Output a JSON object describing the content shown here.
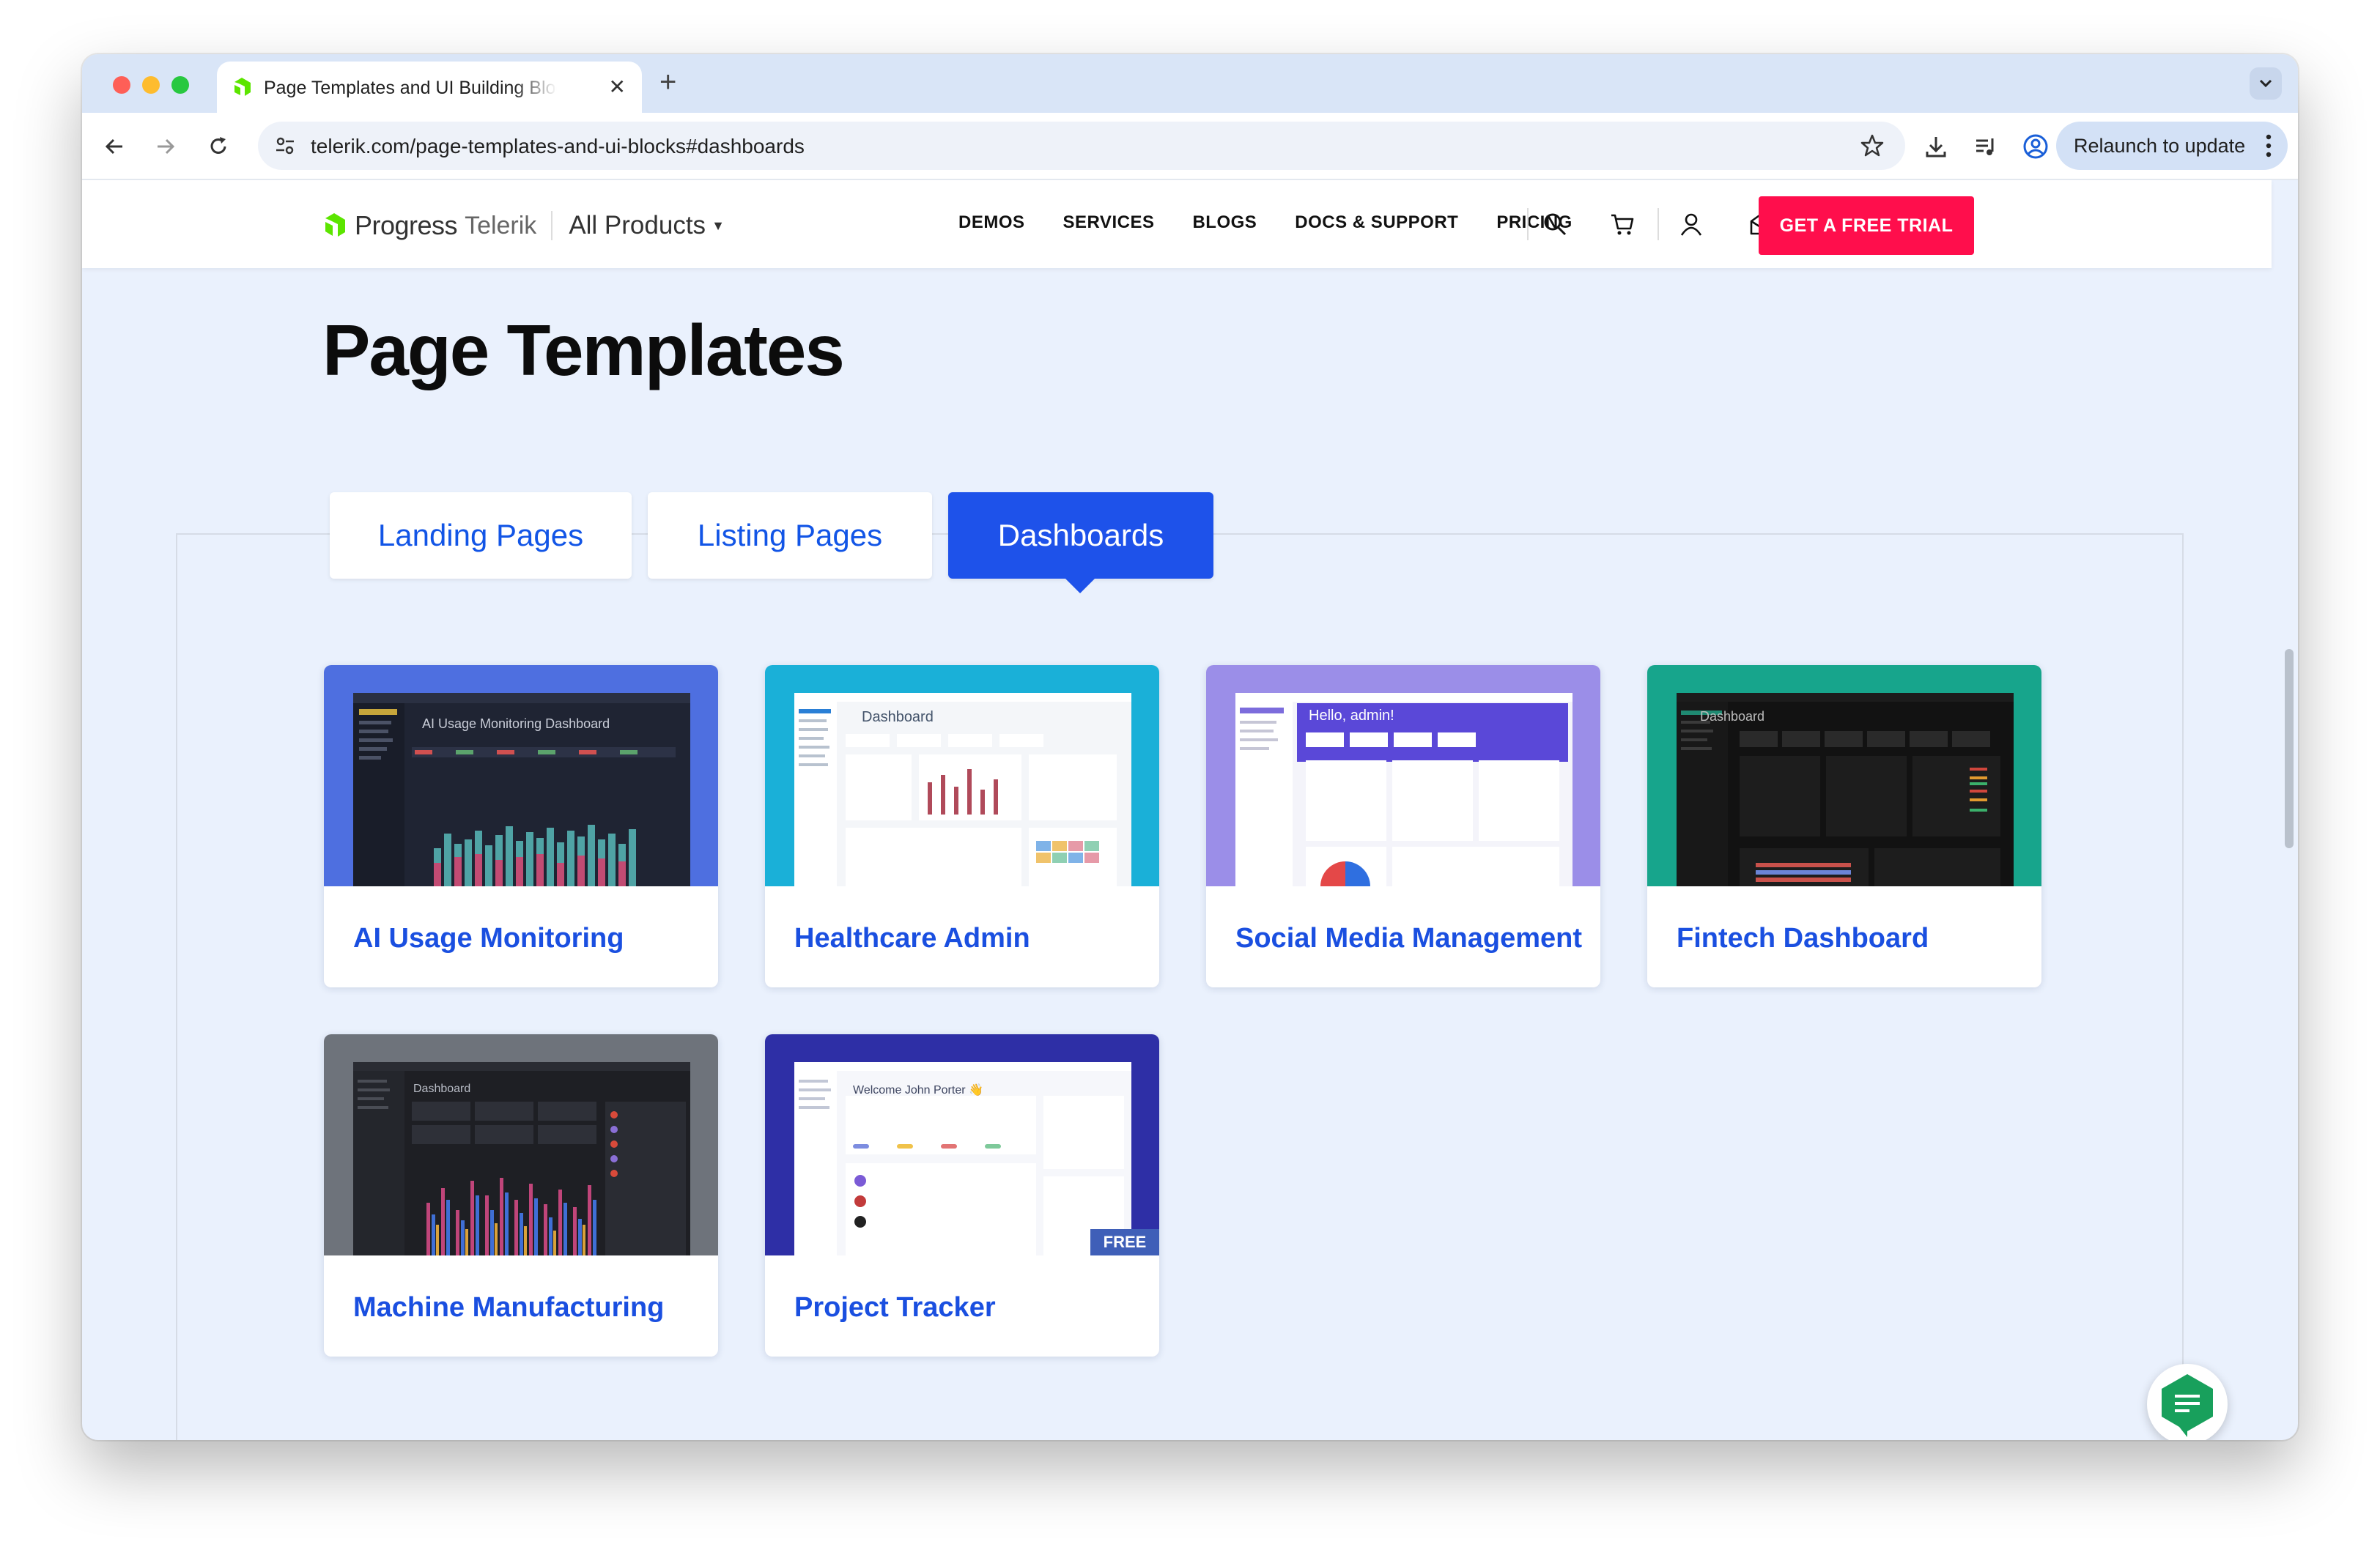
{
  "browser": {
    "tab_title": "Page Templates and UI Building Blocks",
    "tab_close": "✕",
    "new_tab": "+",
    "url": "telerik.com/page-templates-and-ui-blocks#dashboards",
    "relaunch_label": "Relaunch to update"
  },
  "header": {
    "logo_progress": "Progress",
    "logo_telerik": "Telerik",
    "all_products": "All Products",
    "nav": [
      "DEMOS",
      "SERVICES",
      "BLOGS",
      "DOCS & SUPPORT",
      "PRICING"
    ],
    "trial_button": "GET A FREE TRIAL"
  },
  "main": {
    "title": "Page Templates",
    "tabs": [
      {
        "label": "Landing Pages",
        "active": false
      },
      {
        "label": "Listing Pages",
        "active": false
      },
      {
        "label": "Dashboards",
        "active": true
      }
    ],
    "cards": [
      {
        "title": "AI Usage Monitoring",
        "thumb_title": "AI Usage Monitoring Dashboard",
        "theme": "#4e6fe0"
      },
      {
        "title": "Healthcare Admin",
        "thumb_title": "Dashboard",
        "theme": "#1ab0d8"
      },
      {
        "title": "Social Media Management",
        "thumb_title": "Hello, admin!",
        "theme": "#9b8ee8"
      },
      {
        "title": "Fintech Dashboard",
        "thumb_title": "Dashboard",
        "theme": "#17a58c"
      },
      {
        "title": "Machine Manufacturing",
        "thumb_title": "Dashboard",
        "theme": "#6e737b"
      },
      {
        "title": "Project Tracker",
        "thumb_title": "Welcome John Porter 👋",
        "theme": "#2e2fa6",
        "badge": "FREE"
      }
    ]
  },
  "colors": {
    "accent": "#1e52ea",
    "cta": "#ff0e4c",
    "brand_green": "#5ce500"
  }
}
